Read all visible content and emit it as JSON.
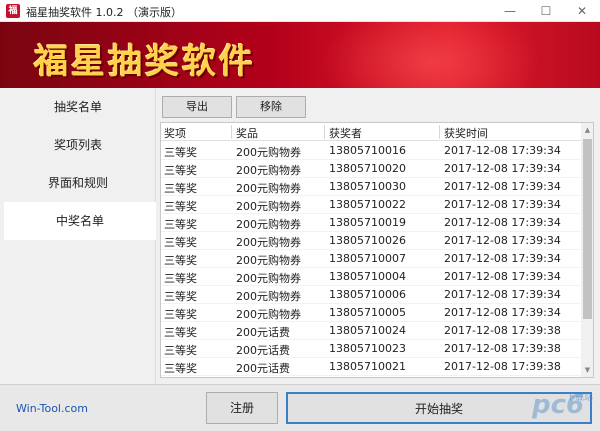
{
  "window": {
    "title": "福星抽奖软件 1.0.2 （演示版）",
    "icon_glyph": "福",
    "minimize_glyph": "—",
    "maximize_glyph": "☐",
    "close_glyph": "✕"
  },
  "banner": {
    "title": "福星抽奖软件"
  },
  "sidebar": {
    "items": [
      {
        "label": "抽奖名单",
        "active": false
      },
      {
        "label": "奖项列表",
        "active": false
      },
      {
        "label": "界面和规则",
        "active": false
      },
      {
        "label": "中奖名单",
        "active": true
      }
    ]
  },
  "toolbar": {
    "export_label": "导出",
    "remove_label": "移除"
  },
  "table": {
    "columns": [
      "奖项",
      "奖品",
      "获奖者",
      "获奖时间"
    ],
    "rows": [
      [
        "三等奖",
        "200元购物券",
        "13805710016",
        "2017-12-08 17:39:34"
      ],
      [
        "三等奖",
        "200元购物券",
        "13805710020",
        "2017-12-08 17:39:34"
      ],
      [
        "三等奖",
        "200元购物券",
        "13805710030",
        "2017-12-08 17:39:34"
      ],
      [
        "三等奖",
        "200元购物券",
        "13805710022",
        "2017-12-08 17:39:34"
      ],
      [
        "三等奖",
        "200元购物券",
        "13805710019",
        "2017-12-08 17:39:34"
      ],
      [
        "三等奖",
        "200元购物券",
        "13805710026",
        "2017-12-08 17:39:34"
      ],
      [
        "三等奖",
        "200元购物券",
        "13805710007",
        "2017-12-08 17:39:34"
      ],
      [
        "三等奖",
        "200元购物券",
        "13805710004",
        "2017-12-08 17:39:34"
      ],
      [
        "三等奖",
        "200元购物券",
        "13805710006",
        "2017-12-08 17:39:34"
      ],
      [
        "三等奖",
        "200元购物券",
        "13805710005",
        "2017-12-08 17:39:34"
      ],
      [
        "三等奖",
        "200元话费",
        "13805710024",
        "2017-12-08 17:39:38"
      ],
      [
        "三等奖",
        "200元话费",
        "13805710023",
        "2017-12-08 17:39:38"
      ],
      [
        "三等奖",
        "200元话费",
        "13805710021",
        "2017-12-08 17:39:38"
      ]
    ]
  },
  "footer": {
    "site_link": "Win-Tool.com",
    "register_label": "注册",
    "start_label": "开始抽奖"
  },
  "watermark": {
    "text": "pc6",
    "sub": "下载站"
  },
  "colors": {
    "banner_red": "#b3001a",
    "banner_title": "#ffd24a",
    "link_blue": "#1a56b0",
    "focus_border": "#3c7fc8"
  }
}
